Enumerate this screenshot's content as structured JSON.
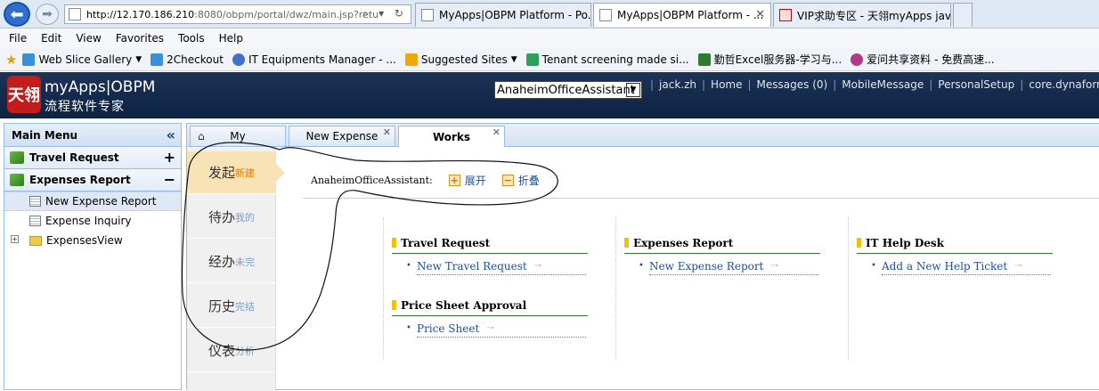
{
  "browser": {
    "url_host": "http://12.170.186.210",
    "url_rest": ":8080/obpm/portal/dwz/main.jsp?retu",
    "address_tools": "⌕ ▾ ↻",
    "tabs": [
      {
        "label": "MyApps|OBPM Platform - Po..."
      },
      {
        "label": "MyApps|OBPM Platform - ..."
      },
      {
        "label": "VIP求助专区 - 天翎myApps jav..."
      }
    ],
    "menu": [
      "File",
      "Edit",
      "View",
      "Favorites",
      "Tools",
      "Help"
    ],
    "favorites": [
      {
        "label": "Web Slice Gallery",
        "dropdown": true,
        "color": "#3a8fd8"
      },
      {
        "label": "2Checkout",
        "dropdown": false,
        "color": "#3a8fd8"
      },
      {
        "label": "IT Equipments Manager - ...",
        "dropdown": false,
        "color": "#3f6fd0"
      },
      {
        "label": "Suggested Sites",
        "dropdown": true,
        "color": "#f0a800"
      },
      {
        "label": "Tenant screening made si...",
        "dropdown": false,
        "color": "#2aa05a"
      },
      {
        "label": "勤哲Excel服务器-学习与...",
        "dropdown": false,
        "color": "#2f7c2f"
      },
      {
        "label": "爱问共享资料 - 免费高速...",
        "dropdown": false,
        "color": "#b03a8a"
      }
    ]
  },
  "header": {
    "logo_mark": "天翎",
    "title": "myApps|OBPM",
    "subtitle": "流程软件专家",
    "app_select_value": "AnaheimOfficeAssistant",
    "user": "jack.zh",
    "links": [
      "Home",
      "Messages (0)",
      "MobileMessage",
      "PersonalSetup",
      "core.dynaform.v"
    ]
  },
  "sidebar": {
    "title": "Main Menu",
    "groups": [
      {
        "label": "Travel Request",
        "toggle": "+"
      },
      {
        "label": "Expenses Report",
        "toggle": "−"
      }
    ],
    "items": [
      {
        "label": "New Expense Report"
      },
      {
        "label": "Expense Inquiry"
      },
      {
        "label": "ExpensesView"
      }
    ]
  },
  "main_tabs": [
    {
      "label": "My"
    },
    {
      "label": "New Expense"
    },
    {
      "label": "Works"
    }
  ],
  "vnav": [
    {
      "big": "发起",
      "small": "新建"
    },
    {
      "big": "待办",
      "small": "我的"
    },
    {
      "big": "经办",
      "small": "未完"
    },
    {
      "big": "历史",
      "small": "完结"
    },
    {
      "big": "仪表",
      "small": "分析"
    }
  ],
  "toolbar": {
    "app_label": "AnaheimOfficeAssistant:",
    "expand": "展开",
    "collapse": "折叠"
  },
  "categories": [
    {
      "title": "Travel Request",
      "links": [
        "New Travel Request"
      ]
    },
    {
      "title": "Expenses Report",
      "links": [
        "New Expense Report"
      ]
    },
    {
      "title": "IT Help Desk",
      "links": [
        "Add a New Help Ticket"
      ]
    },
    {
      "title": "Price Sheet Approval",
      "links": [
        "Price Sheet"
      ]
    }
  ]
}
